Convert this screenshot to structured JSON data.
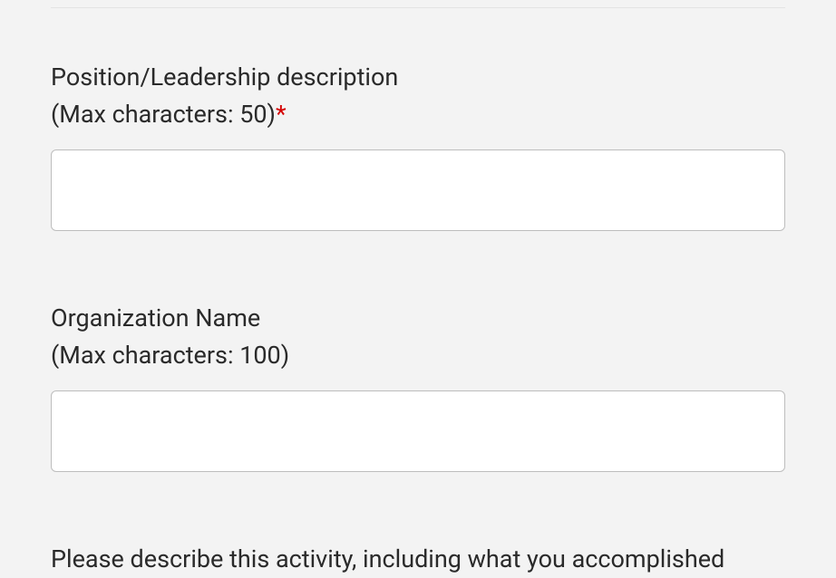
{
  "fields": {
    "position": {
      "label_line1": "Position/Leadership description",
      "label_line2": "(Max characters: 50)",
      "required_mark": "*",
      "value": ""
    },
    "organization": {
      "label_line1": "Organization Name",
      "label_line2": "(Max characters: 100)",
      "value": ""
    },
    "description": {
      "label_line1": "Please describe this activity, including what you accomplished"
    }
  }
}
